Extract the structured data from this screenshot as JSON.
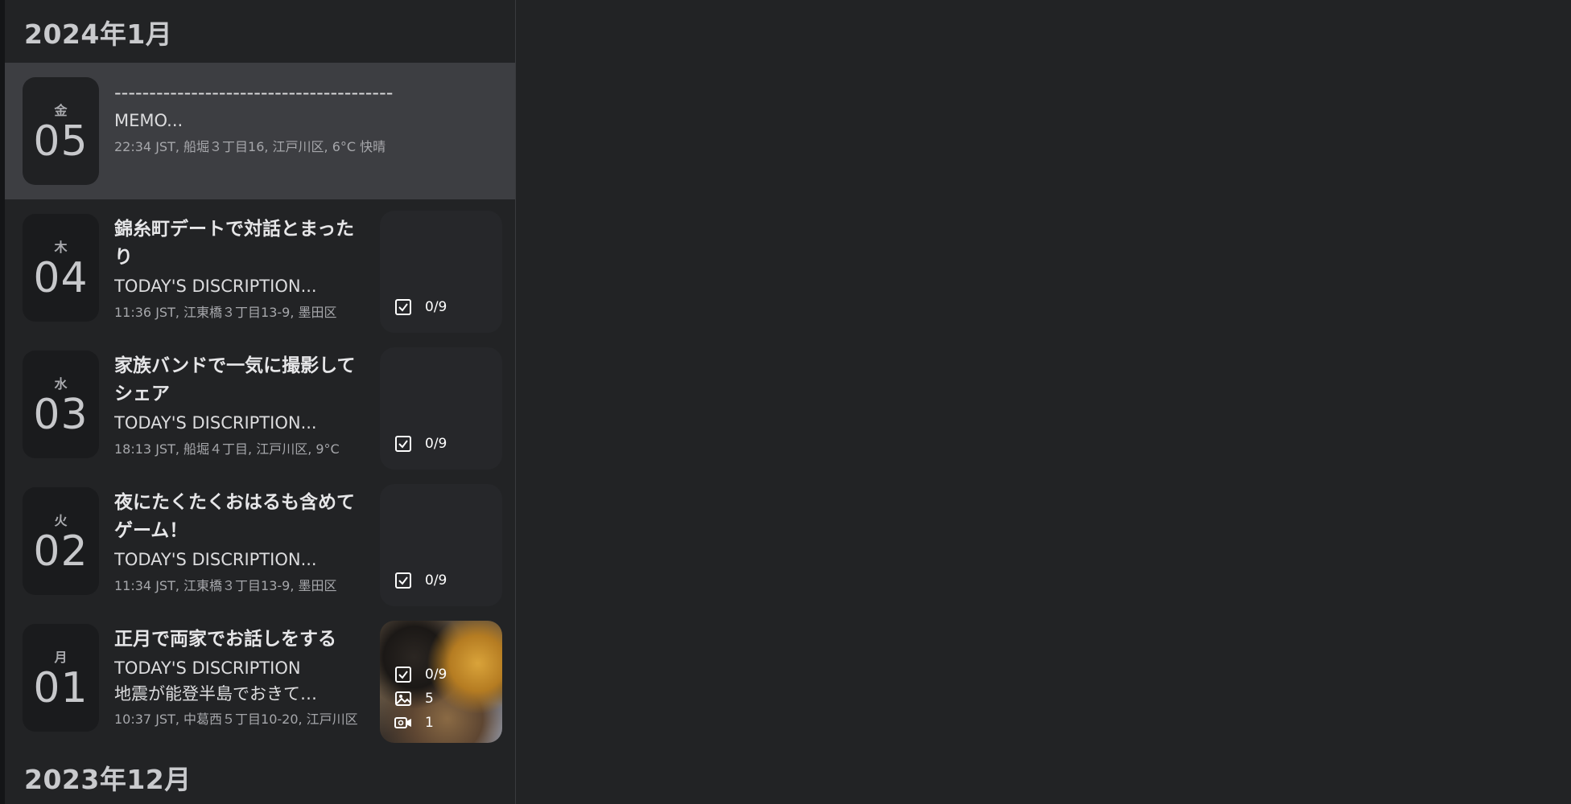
{
  "months": [
    {
      "label": "2024年1月"
    },
    {
      "label": "2023年12月"
    }
  ],
  "entries": [
    {
      "weekday": "金",
      "day": "05",
      "title": "----------------------------------------",
      "desc": "MEMO...",
      "meta": "22:34 JST,  船堀３丁目16, 江戸川区,  6°C 快晴"
    },
    {
      "weekday": "木",
      "day": "04",
      "title": "錦糸町デートで対話とまったり",
      "desc": "TODAY'S DISCRIPTION...",
      "meta": "11:36 JST,  江東橋３丁目13-9, 墨田区",
      "tasks": "0/9"
    },
    {
      "weekday": "水",
      "day": "03",
      "title": "家族バンドで一気に撮影してシェア",
      "desc": "TODAY'S DISCRIPTION...",
      "meta": "18:13 JST,  船堀４丁目, 江戸川区,  9°C",
      "tasks": "0/9"
    },
    {
      "weekday": "火",
      "day": "02",
      "title": "夜にたくたくおはるも含めてゲーム！",
      "desc": "TODAY'S DISCRIPTION...",
      "meta": "11:34 JST,  江東橋３丁目13-9, 墨田区",
      "tasks": "0/9"
    },
    {
      "weekday": "月",
      "day": "01",
      "title": "正月で両家でお話しをする",
      "desc": "TODAY'S DISCRIPTION",
      "desc2": "地震が能登半島でおきて…",
      "meta": "10:37 JST,  中葛西５丁目10-20, 江戸川区",
      "tasks": "0/9",
      "photos": "5",
      "videos": "1"
    }
  ]
}
